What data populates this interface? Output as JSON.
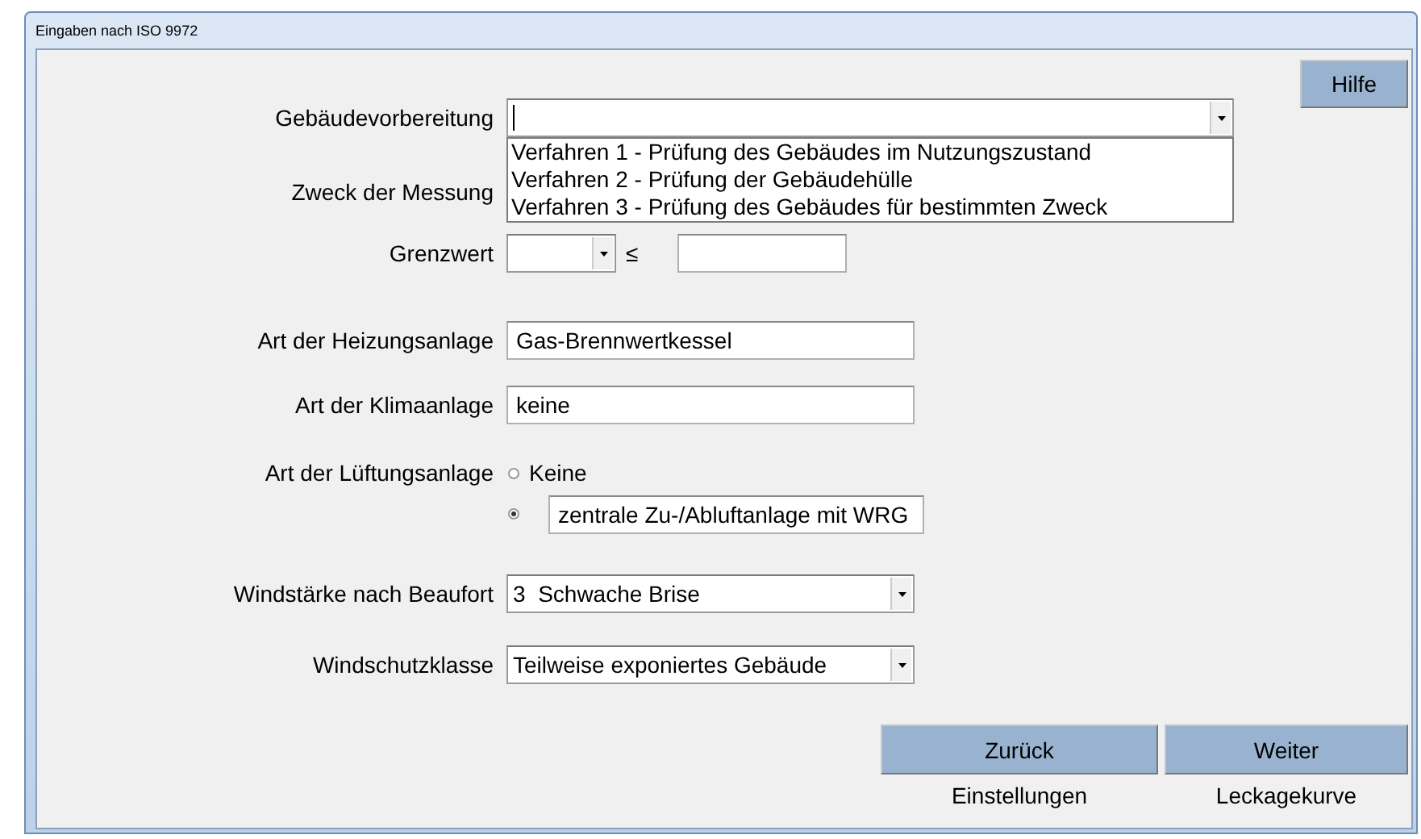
{
  "window": {
    "title": "Eingaben nach ISO 9972"
  },
  "help_button": "Hilfe",
  "fields": [
    {
      "kind": "combo",
      "label": "Gebäudevorbereitung",
      "expanded": true,
      "options": [
        "Verfahren 1 - Prüfung des Gebäudes im Nutzungszustand",
        "Verfahren 2 - Prüfung der Gebäudehülle",
        "Verfahren 3 - Prüfung des Gebäudes für bestimmten Zweck"
      ]
    },
    {
      "kind": "label",
      "label": "Zweck der Messung"
    },
    {
      "kind": "limit",
      "label": "Grenzwert",
      "operator": "≤"
    },
    {
      "kind": "text",
      "label": "Art der Heizungsanlage",
      "value": "Gas-Brennwertkessel"
    },
    {
      "kind": "text",
      "label": "Art der Klimaanlage",
      "value": "keine"
    },
    {
      "kind": "radio",
      "label": "Art der Lüftungsanlage",
      "options": [
        {
          "kind": "plain",
          "label": "Keine",
          "selected": false
        },
        {
          "kind": "field",
          "label": "zentrale Zu-/Abluftanlage mit WRG",
          "selected": true
        }
      ]
    },
    {
      "kind": "combo",
      "label": "Windstärke nach Beaufort",
      "value": "3  Schwache Brise"
    },
    {
      "kind": "combo",
      "label": "Windschutzklasse",
      "value": "Teilweise exponiertes Gebäude"
    }
  ],
  "nav_buttons": [
    {
      "label": "Zurück",
      "caption": "Einstellungen"
    },
    {
      "label": "Weiter",
      "caption": "Leckagekurve"
    }
  ]
}
